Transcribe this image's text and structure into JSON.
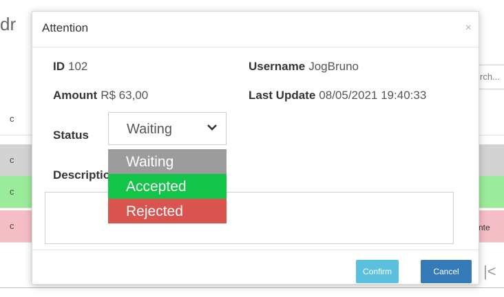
{
  "background": {
    "title_fragment": "dr",
    "search_placeholder": "rch...",
    "col_fragment": "c",
    "rows": [
      {
        "left": "c",
        "right": ""
      },
      {
        "left": "c",
        "right": ""
      },
      {
        "left": "c",
        "right": "tente"
      }
    ],
    "nav_glyph": "|<"
  },
  "modal": {
    "title": "Attention",
    "close_glyph": "×",
    "id_label": "ID",
    "id_value": "102",
    "username_label": "Username",
    "username_value": "JogBruno",
    "amount_label": "Amount",
    "amount_value": "R$ 63,00",
    "last_update_label": "Last Update",
    "last_update_value": "08/05/2021 19:40:33",
    "status_label": "Status",
    "status_selected": "Waiting",
    "status_options": [
      {
        "label": "Waiting",
        "color": "#9c9c9c"
      },
      {
        "label": "Accepted",
        "color": "#12c548"
      },
      {
        "label": "Rejected",
        "color": "#d9534f"
      }
    ],
    "description_label": "Description",
    "confirm_label": "Confirm",
    "cancel_label": "Cancel"
  },
  "colors": {
    "confirm_button": "#5bc0de",
    "cancel_button": "#337ab7"
  }
}
